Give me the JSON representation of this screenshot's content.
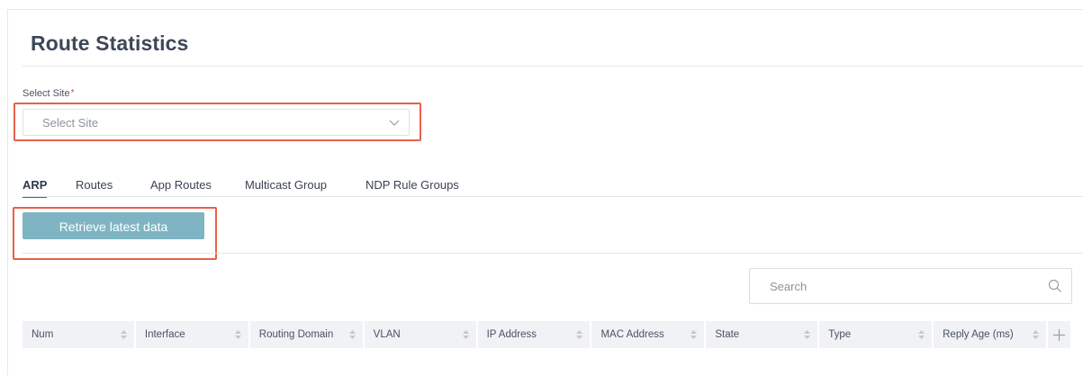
{
  "page": {
    "title": "Route Statistics"
  },
  "site_select": {
    "label": "Select Site",
    "required_mark": "*",
    "placeholder": "Select Site"
  },
  "tabs": [
    {
      "label": "ARP",
      "active": true
    },
    {
      "label": "Routes",
      "active": false
    },
    {
      "label": "App Routes",
      "active": false
    },
    {
      "label": "Multicast Group",
      "active": false
    },
    {
      "label": "NDP Rule Groups",
      "active": false
    }
  ],
  "retrieve_button": {
    "label": "Retrieve latest data"
  },
  "search": {
    "placeholder": "Search"
  },
  "table": {
    "columns": [
      "Num",
      "Interface",
      "Routing Domain",
      "VLAN",
      "IP Address",
      "MAC Address",
      "State",
      "Type",
      "Reply Age (ms)"
    ],
    "add_column_icon": "plus-icon"
  },
  "colors": {
    "accent_tab": "#3b6d88",
    "button_bg": "#7fb5c3",
    "highlight": "#e8604c",
    "required": "#d93a3a"
  }
}
